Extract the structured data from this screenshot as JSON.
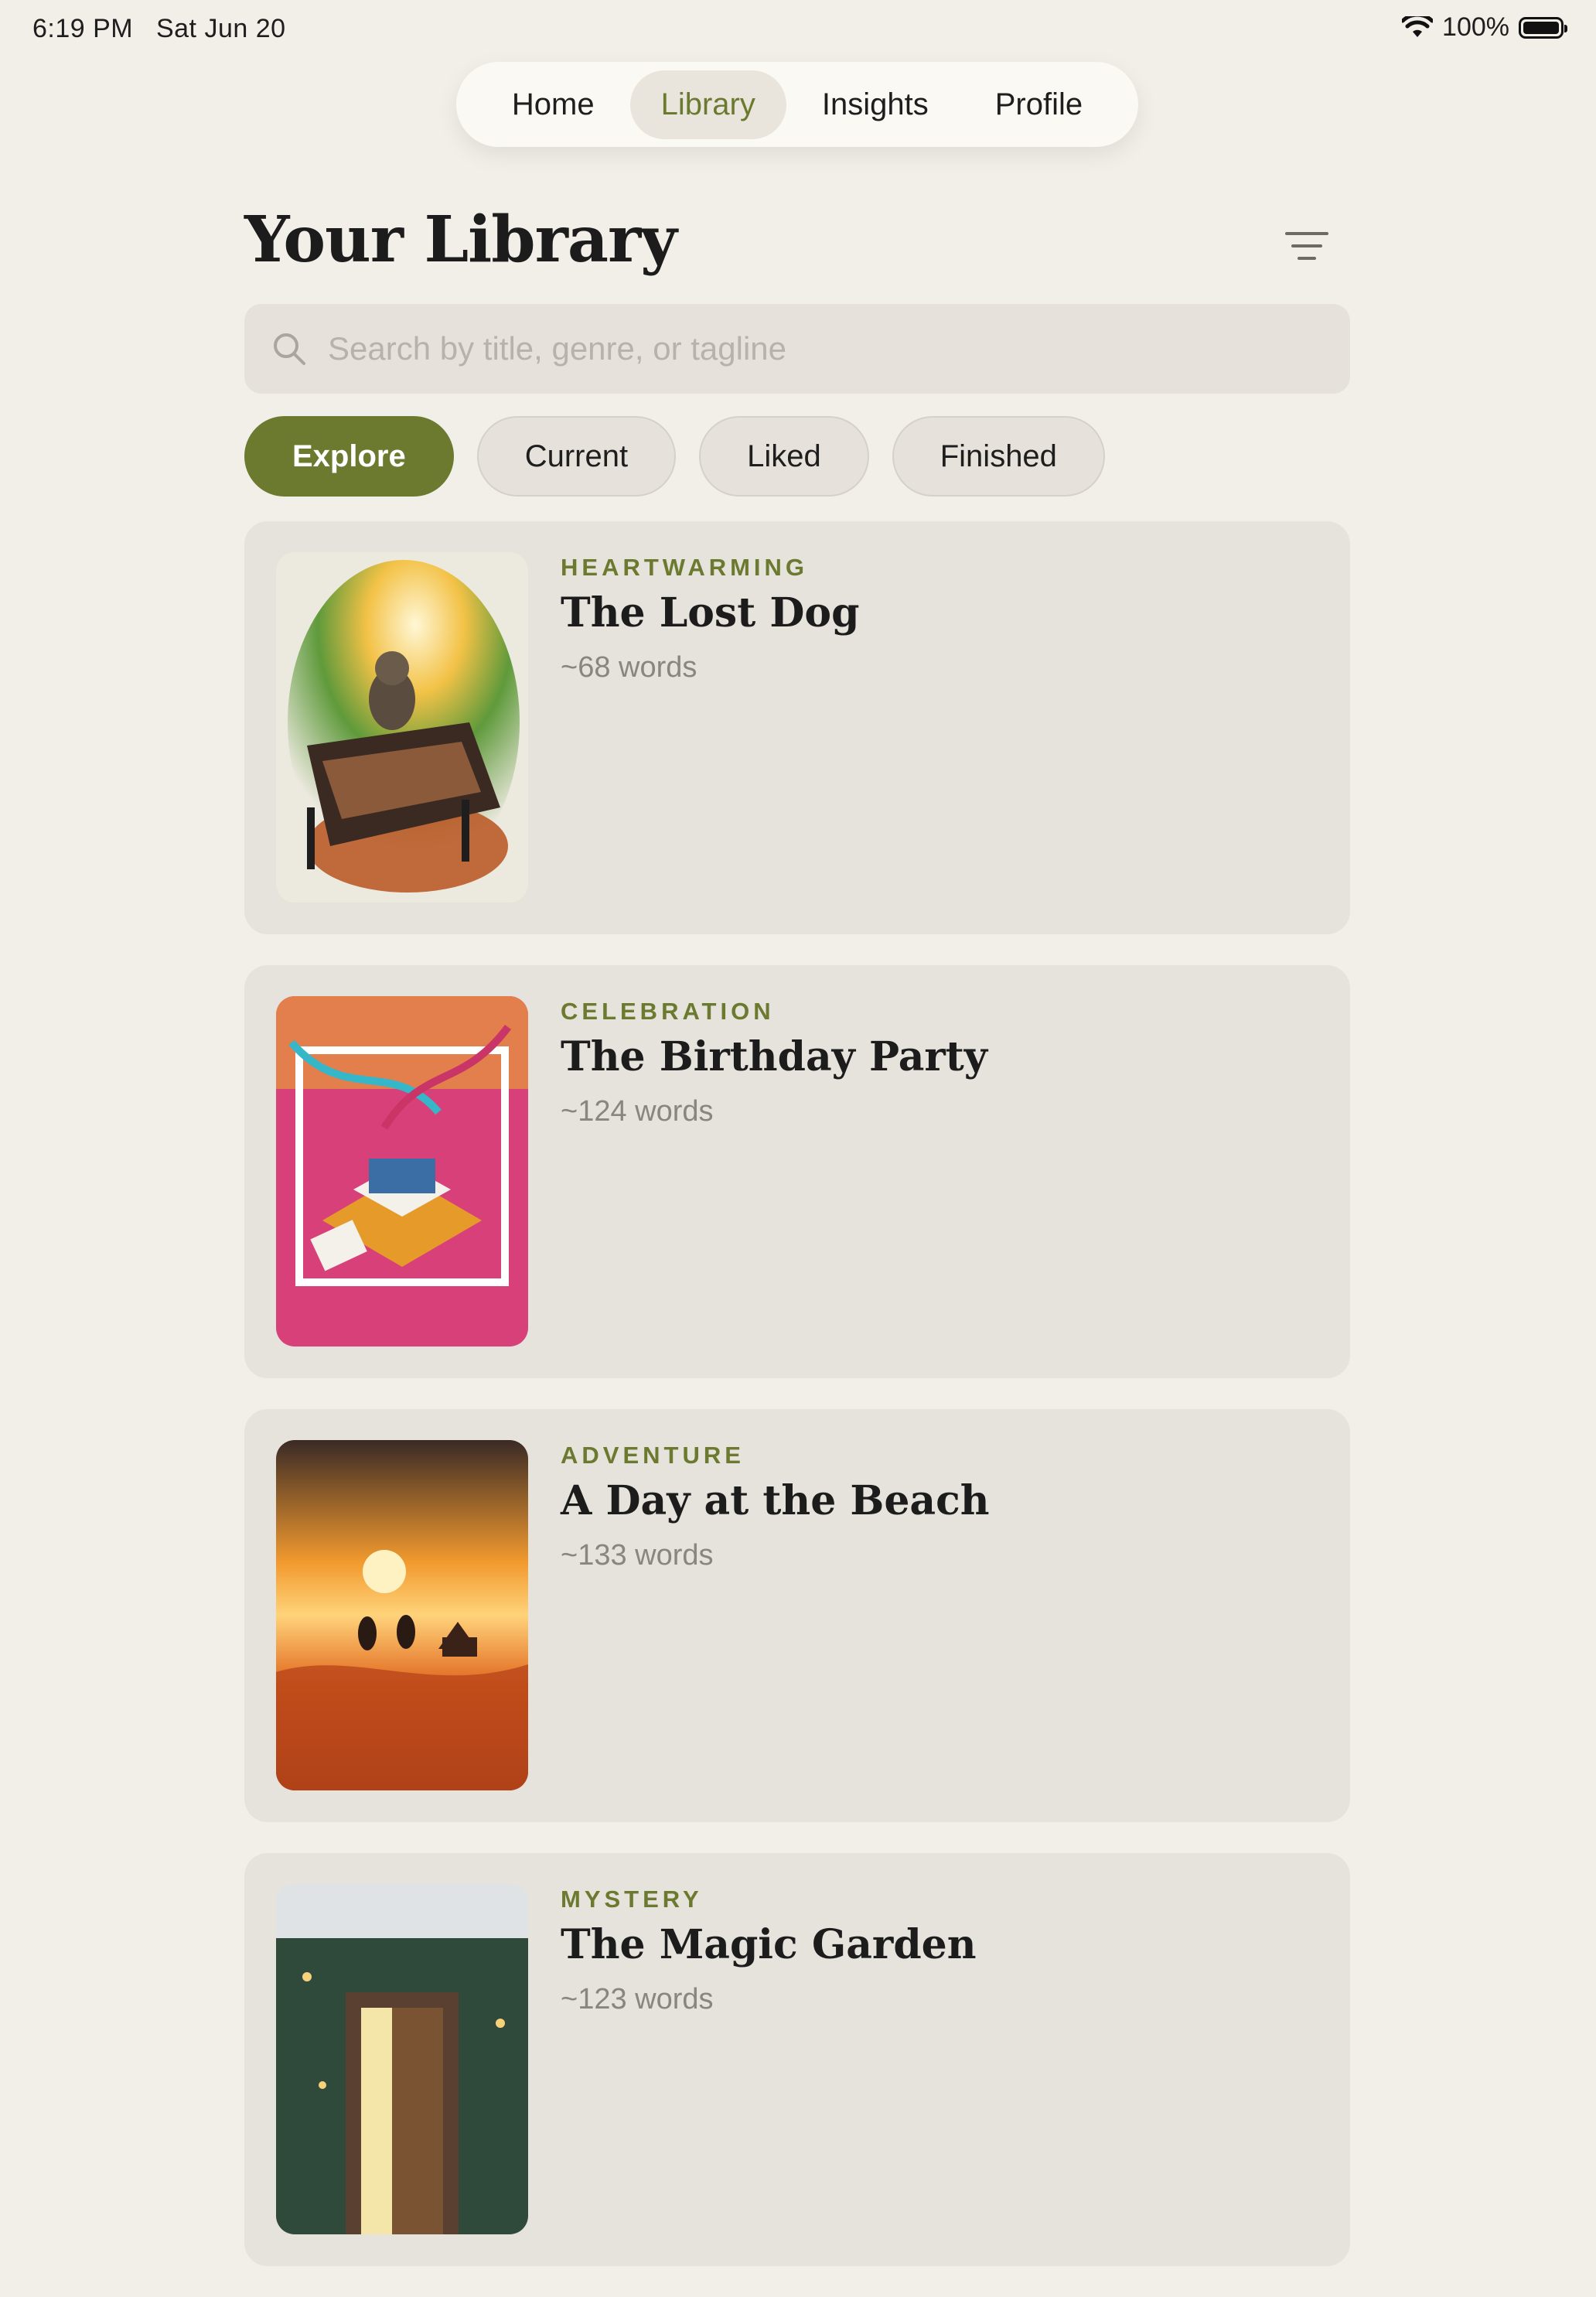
{
  "status_bar": {
    "time": "6:19 PM",
    "date": "Sat Jun 20",
    "battery": "100%",
    "wifi_icon": "wifi-icon",
    "battery_icon": "battery-icon"
  },
  "nav": {
    "tabs": [
      "Home",
      "Library",
      "Insights",
      "Profile"
    ],
    "active": "Library"
  },
  "header": {
    "title": "Your Library",
    "filter_icon": "filter-lines-icon"
  },
  "search": {
    "placeholder": "Search by title, genre, or tagline",
    "value": "",
    "icon": "search-icon"
  },
  "filters": {
    "chips": [
      "Explore",
      "Current",
      "Liked",
      "Finished"
    ],
    "active": "Explore"
  },
  "stories": [
    {
      "genre": "HEARTWARMING",
      "title": "The Lost Dog",
      "words": "~68 words"
    },
    {
      "genre": "CELEBRATION",
      "title": "The Birthday Party",
      "words": "~124 words"
    },
    {
      "genre": "ADVENTURE",
      "title": "A Day at the Beach",
      "words": "~133 words"
    },
    {
      "genre": "MYSTERY",
      "title": "The Magic Garden",
      "words": "~123 words"
    }
  ],
  "colors": {
    "accent": "#6b7a2f",
    "background": "#f2efe9",
    "card": "#e6e2dc",
    "muted_text": "#8a857e"
  }
}
